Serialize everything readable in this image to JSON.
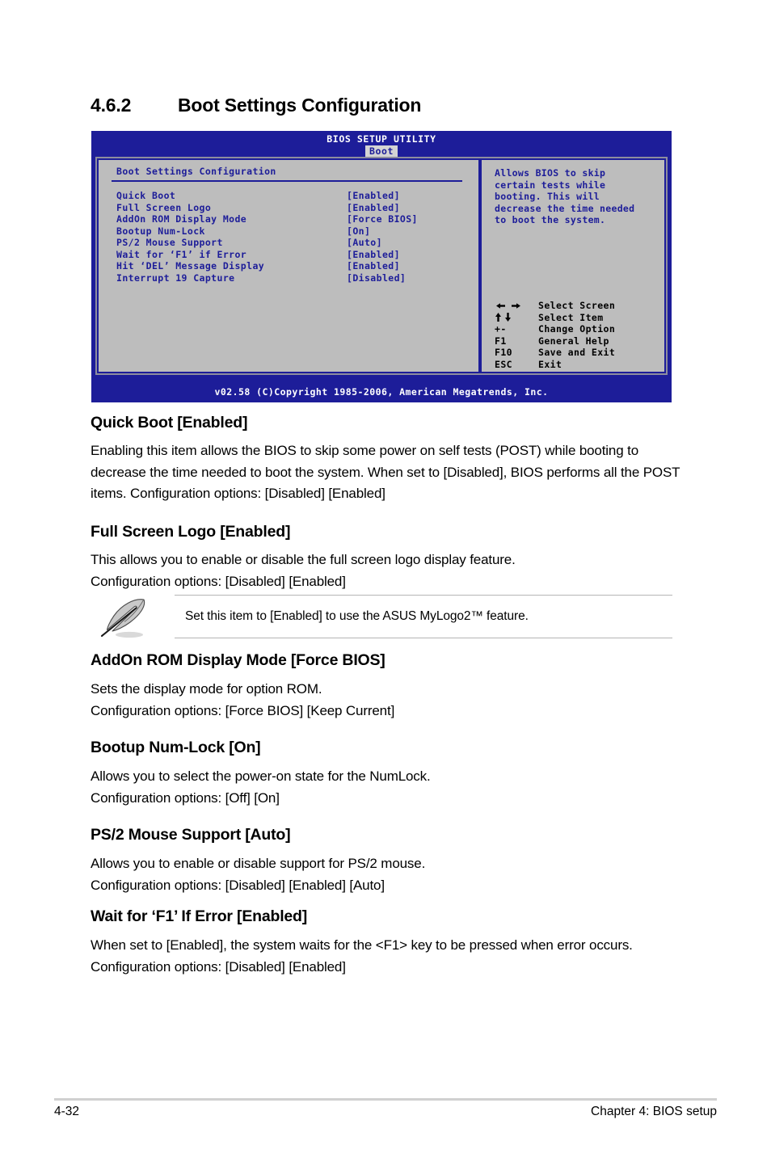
{
  "section": {
    "number": "4.6.2",
    "title": "Boot Settings Configuration"
  },
  "bios": {
    "utility_title": "BIOS SETUP UTILITY",
    "active_tab": "Boot",
    "panel_title": "Boot Settings Configuration",
    "items": [
      {
        "label": "Quick Boot",
        "value": "[Enabled]"
      },
      {
        "label": "Full Screen Logo",
        "value": "[Enabled]"
      },
      {
        "label": "AddOn ROM Display Mode",
        "value": "[Force BIOS]"
      },
      {
        "label": "Bootup Num-Lock",
        "value": "[On]"
      },
      {
        "label": "PS/2 Mouse Support",
        "value": "[Auto]"
      },
      {
        "label": "Wait for ‘F1’ if Error",
        "value": "[Enabled]"
      },
      {
        "label": "Hit ‘DEL’ Message Display",
        "value": "[Enabled]"
      },
      {
        "label": "Interrupt 19 Capture",
        "value": "[Disabled]"
      }
    ],
    "help": "Allows BIOS to skip\ncertain tests while\nbooting. This will\ndecrease the time needed\nto boot the system.",
    "keys": [
      {
        "cap": "",
        "icon": "left-right-arrows",
        "label": "Select Screen"
      },
      {
        "cap": "",
        "icon": "up-down-arrows",
        "label": "Select Item"
      },
      {
        "cap": "+-",
        "icon": "",
        "label": "Change Option"
      },
      {
        "cap": "F1",
        "icon": "",
        "label": "General Help"
      },
      {
        "cap": "F10",
        "icon": "",
        "label": "Save and Exit"
      },
      {
        "cap": "ESC",
        "icon": "",
        "label": "Exit"
      }
    ],
    "copyright": "v02.58 (C)Copyright 1985-2006, American Megatrends, Inc.",
    "colors": {
      "header_blue": "#1d1d99",
      "panel_gray": "#bdbdbd",
      "tab_gray": "#d4d4d4",
      "text_blue": "#1d1d99"
    }
  },
  "sections": [
    {
      "heading": "Quick Boot [Enabled]",
      "body": "Enabling this item allows the BIOS to skip some power on self tests (POST) while booting to decrease the time needed to boot the system. When set to [Disabled], BIOS performs all the POST items. Configuration options: [Disabled] [Enabled]"
    },
    {
      "heading": "Full Screen Logo [Enabled]",
      "body": "This allows you to enable or disable the full screen logo display feature.\nConfiguration options: [Disabled] [Enabled]"
    },
    {
      "heading": "AddOn ROM Display Mode [Force BIOS]",
      "body": "Sets the display mode for option ROM.\nConfiguration options: [Force BIOS] [Keep Current]"
    },
    {
      "heading": "Bootup Num-Lock [On]",
      "body": "Allows you to select the power-on state for the NumLock.\nConfiguration options: [Off] [On]"
    },
    {
      "heading": "PS/2 Mouse Support [Auto]",
      "body": "Allows you to enable or disable support for PS/2 mouse.\nConfiguration options: [Disabled] [Enabled] [Auto]"
    },
    {
      "heading": "Wait for ‘F1’ If Error [Enabled]",
      "body": "When set to [Enabled], the system waits for the <F1> key to be pressed when error occurs. Configuration options: [Disabled] [Enabled]"
    }
  ],
  "note": {
    "icon": "quill-pen-icon",
    "text": "Set this item to [Enabled] to use the ASUS MyLogo2™ feature."
  },
  "footer": {
    "page": "4-32",
    "chapter": "Chapter 4: BIOS setup"
  }
}
